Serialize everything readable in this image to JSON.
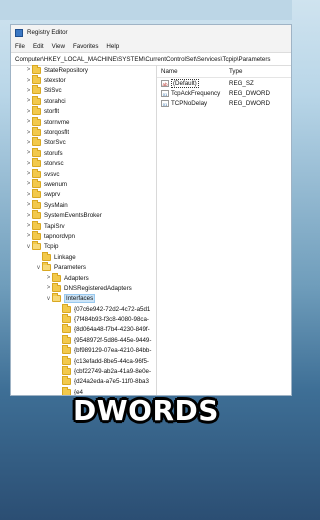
{
  "window": {
    "title": "Registry Editor"
  },
  "menu": [
    "File",
    "Edit",
    "View",
    "Favorites",
    "Help"
  ],
  "address": "Computer\\HKEY_LOCAL_MACHINE\\SYSTEM\\CurrentControlSet\\Services\\Tcpip\\Parameters",
  "tree": [
    {
      "label": "StateRepository",
      "level": 0,
      "expander": ">",
      "open": false,
      "selected": false
    },
    {
      "label": "stexstor",
      "level": 0,
      "expander": ">",
      "open": false,
      "selected": false
    },
    {
      "label": "StiSvc",
      "level": 0,
      "expander": ">",
      "open": false,
      "selected": false
    },
    {
      "label": "storahci",
      "level": 0,
      "expander": ">",
      "open": false,
      "selected": false
    },
    {
      "label": "storflt",
      "level": 0,
      "expander": ">",
      "open": false,
      "selected": false
    },
    {
      "label": "stornvme",
      "level": 0,
      "expander": ">",
      "open": false,
      "selected": false
    },
    {
      "label": "storqosflt",
      "level": 0,
      "expander": ">",
      "open": false,
      "selected": false
    },
    {
      "label": "StorSvc",
      "level": 0,
      "expander": ">",
      "open": false,
      "selected": false
    },
    {
      "label": "storufs",
      "level": 0,
      "expander": ">",
      "open": false,
      "selected": false
    },
    {
      "label": "storvsc",
      "level": 0,
      "expander": ">",
      "open": false,
      "selected": false
    },
    {
      "label": "svsvc",
      "level": 0,
      "expander": ">",
      "open": false,
      "selected": false
    },
    {
      "label": "swenum",
      "level": 0,
      "expander": ">",
      "open": false,
      "selected": false
    },
    {
      "label": "swprv",
      "level": 0,
      "expander": ">",
      "open": false,
      "selected": false
    },
    {
      "label": "SysMain",
      "level": 0,
      "expander": ">",
      "open": false,
      "selected": false
    },
    {
      "label": "SystemEventsBroker",
      "level": 0,
      "expander": ">",
      "open": false,
      "selected": false
    },
    {
      "label": "TapiSrv",
      "level": 0,
      "expander": ">",
      "open": false,
      "selected": false
    },
    {
      "label": "tapnordvpn",
      "level": 0,
      "expander": ">",
      "open": false,
      "selected": false
    },
    {
      "label": "Tcpip",
      "level": 0,
      "expander": "v",
      "open": true,
      "selected": false
    },
    {
      "label": "Linkage",
      "level": 1,
      "expander": "",
      "open": false,
      "selected": false
    },
    {
      "label": "Parameters",
      "level": 1,
      "expander": "v",
      "open": true,
      "selected": false
    },
    {
      "label": "Adapters",
      "level": 2,
      "expander": ">",
      "open": false,
      "selected": false
    },
    {
      "label": "DNSRegisteredAdapters",
      "level": 2,
      "expander": ">",
      "open": false,
      "selected": false
    },
    {
      "label": "Interfaces",
      "level": 2,
      "expander": "v",
      "open": true,
      "selected": true
    },
    {
      "label": "{07c6e942-72d2-4c72-a5d1",
      "level": 3,
      "expander": "",
      "open": false,
      "selected": false
    },
    {
      "label": "{7f484b93-f3c8-4080-98ca-",
      "level": 3,
      "expander": "",
      "open": false,
      "selected": false
    },
    {
      "label": "{8d064a48-f7b4-4230-849f-",
      "level": 3,
      "expander": "",
      "open": false,
      "selected": false
    },
    {
      "label": "{9548972f-5d86-445e-9449-",
      "level": 3,
      "expander": "",
      "open": false,
      "selected": false
    },
    {
      "label": "{bf989129-07ea-4210-84bb-",
      "level": 3,
      "expander": "",
      "open": false,
      "selected": false
    },
    {
      "label": "{c13efadd-8be5-44ca-96f5-",
      "level": 3,
      "expander": "",
      "open": false,
      "selected": false
    },
    {
      "label": "{cbf22749-ab2a-41a9-8e0e-",
      "level": 3,
      "expander": "",
      "open": false,
      "selected": false
    },
    {
      "label": "{d24a2eda-a7e5-11f0-8ba3",
      "level": 3,
      "expander": "",
      "open": false,
      "selected": false
    },
    {
      "label": "{e4",
      "level": 3,
      "expander": "",
      "open": false,
      "selected": false
    }
  ],
  "values_pane": {
    "headers": {
      "name": "Name",
      "type": "Type"
    },
    "rows": [
      {
        "name": "(Default)",
        "type": "REG_SZ",
        "icon": "string-value-icon",
        "selected": true
      },
      {
        "name": "TcpAckFrequency",
        "type": "REG_DWORD",
        "icon": "binary-value-icon",
        "selected": false
      },
      {
        "name": "TCPNoDelay",
        "type": "REG_DWORD",
        "icon": "binary-value-icon",
        "selected": false
      }
    ]
  },
  "caption": "DWORDS"
}
